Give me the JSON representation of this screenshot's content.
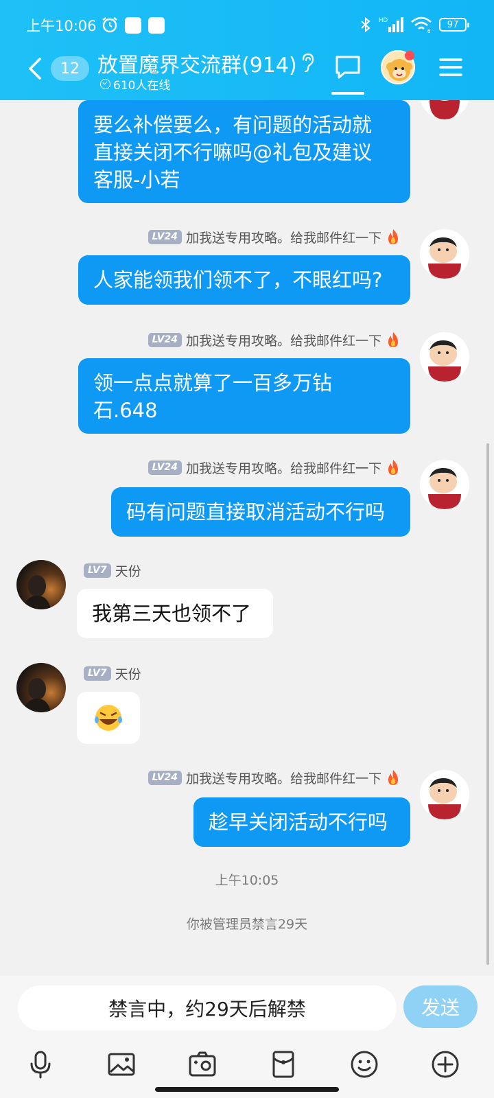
{
  "status_bar": {
    "time": "上午10:06",
    "network_label": "HD",
    "wifi_sub": "6",
    "battery": "97"
  },
  "header": {
    "back_badge": "12",
    "title": "放置魔界交流群(914)",
    "online_count": "610人在线"
  },
  "messages": [
    {
      "side": "out",
      "sender": "加我送专用攻略。给我邮件红一下",
      "level": "LV24",
      "text_lines": [
        "要么补偿要么，有问题的活动就",
        "直接关闭不行嘛吗@礼包及建议",
        "客服-小若"
      ]
    },
    {
      "side": "out",
      "sender": "加我送专用攻略。给我邮件红一下",
      "level": "LV24",
      "text_lines": [
        "人家能领我们领不了，不眼红吗?"
      ]
    },
    {
      "side": "out",
      "sender": "加我送专用攻略。给我邮件红一下",
      "level": "LV24",
      "text_lines": [
        "领一点点就算了一百多万钻",
        "石.648"
      ]
    },
    {
      "side": "out",
      "sender": "加我送专用攻略。给我邮件红一下",
      "level": "LV24",
      "text_lines": [
        "码有问题直接取消活动不行吗"
      ]
    },
    {
      "side": "in",
      "sender": "天份",
      "level": "LV7",
      "text_lines": [
        "我第三天也领不了"
      ]
    },
    {
      "side": "in",
      "sender": "天份",
      "level": "LV7",
      "emoji": "laughing-crying-emoji"
    },
    {
      "side": "out",
      "sender": "加我送专用攻略。给我邮件红一下",
      "level": "LV24",
      "text_lines": [
        "趁早关闭活动不行吗"
      ]
    }
  ],
  "timestamp": "上午10:05",
  "system_notice": "你被管理员禁言29天",
  "input": {
    "muted_text": "禁言中，约29天后解禁",
    "send_label": "发送"
  },
  "toolbar": [
    "mic-icon",
    "image-icon",
    "camera-icon",
    "red-packet-icon",
    "emoji-icon",
    "plus-icon"
  ],
  "colors": {
    "header": "#12b6f5",
    "bubble_out": "#0e99f5",
    "bubble_in": "#ffffff",
    "send_disabled": "#8fd2f6"
  }
}
